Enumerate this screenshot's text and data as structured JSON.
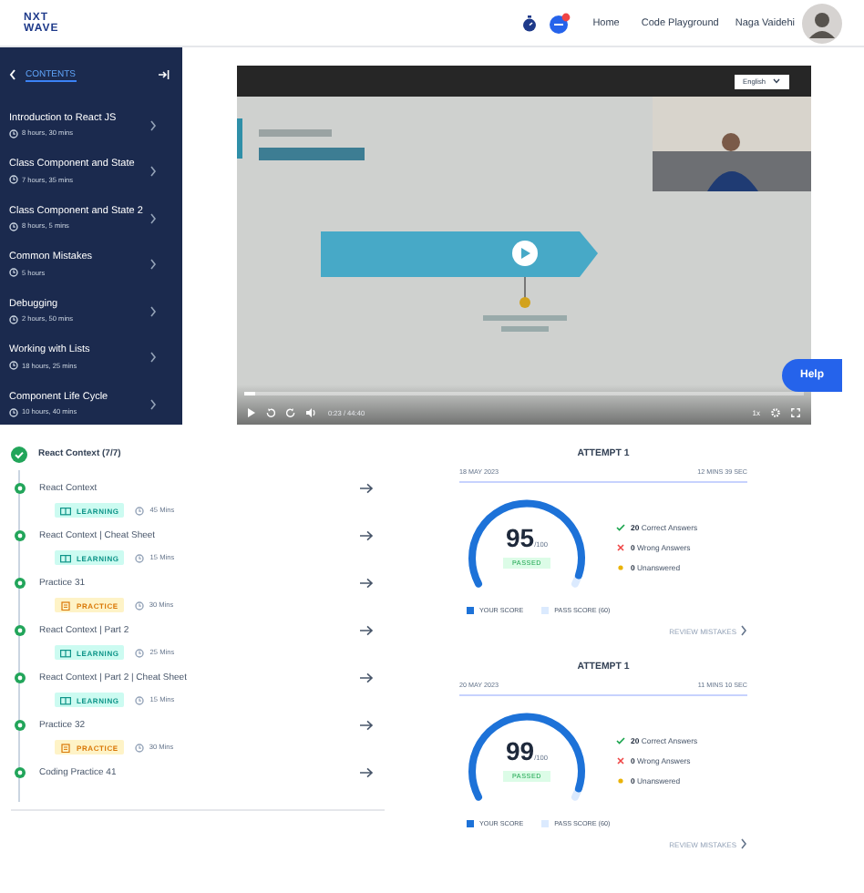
{
  "header": {
    "logo": [
      "NXT",
      "WAVE"
    ],
    "links": [
      "Home",
      "Code Playground"
    ],
    "user_name": "Naga Vaidehi",
    "notification": true
  },
  "sidebar": {
    "title": "CONTENTS",
    "items": [
      {
        "title": "Introduction to React JS",
        "duration": "8 hours, 30 mins"
      },
      {
        "title": "Class Component and State",
        "duration": "7 hours, 35 mins"
      },
      {
        "title": "Class Component and State 2",
        "duration": "8 hours, 5 mins"
      },
      {
        "title": "Common Mistakes",
        "duration": "5 hours"
      },
      {
        "title": "Debugging",
        "duration": "2 hours, 50 mins"
      },
      {
        "title": "Working with Lists",
        "duration": "18 hours, 25 mins"
      },
      {
        "title": "Component Life Cycle",
        "duration": "10 hours, 40 mins"
      }
    ]
  },
  "video": {
    "language": "English",
    "time": "0:23 / 44:40",
    "speed": "1x",
    "level": 0.02,
    "help": "Help"
  },
  "modules": {
    "title": "React Context (7/7)",
    "completed": true,
    "items": [
      {
        "title": "React Context",
        "kind": "learning",
        "tag": "LEARNING",
        "duration": "45 Mins",
        "completed": true
      },
      {
        "title": "React Context | Cheat Sheet",
        "kind": "learning",
        "tag": "LEARNING",
        "duration": "15 Mins",
        "completed": true
      },
      {
        "title": "Practice 31",
        "kind": "practice",
        "tag": "PRACTICE",
        "duration": "30 Mins",
        "completed": true
      },
      {
        "title": "React Context | Part 2",
        "kind": "learning",
        "tag": "LEARNING",
        "duration": "25 Mins",
        "completed": true
      },
      {
        "title": "React Context | Part 2 | Cheat Sheet",
        "kind": "learning",
        "tag": "LEARNING",
        "duration": "15 Mins",
        "completed": true
      },
      {
        "title": "Practice 32",
        "kind": "practice",
        "tag": "PRACTICE",
        "duration": "30 Mins",
        "completed": true
      },
      {
        "title": "Coding Practice 41",
        "completed": true
      }
    ]
  },
  "attempts": [
    {
      "title": "ATTEMPT 1",
      "date": "18 MAY 2023",
      "time_taken": "12 MINS 39 SEC",
      "score": "95",
      "total": "/100",
      "status": "PASSED",
      "stats": [
        {
          "kind": "correct",
          "count": "20",
          "label": "Correct Answers"
        },
        {
          "kind": "wrong",
          "count": "0",
          "label": "Wrong Answers"
        },
        {
          "kind": "unanswered",
          "count": "0",
          "label": "Unanswered"
        }
      ],
      "legend": [
        "YOUR SCORE",
        "PASS SCORE (60)"
      ],
      "link": "REVIEW MISTAKES"
    },
    {
      "title": "ATTEMPT 1",
      "date": "20 MAY 2023",
      "time_taken": "11 MINS 10 SEC",
      "score": "99",
      "total": "/100",
      "status": "PASSED",
      "stats": [
        {
          "kind": "correct",
          "count": "20",
          "label": "Correct Answers"
        },
        {
          "kind": "wrong",
          "count": "0",
          "label": "Wrong Answers"
        },
        {
          "kind": "unanswered",
          "count": "0",
          "label": "Unanswered"
        }
      ],
      "legend": [
        "YOUR SCORE",
        "PASS SCORE (60)"
      ],
      "link": "REVIEW MISTAKES"
    }
  ]
}
